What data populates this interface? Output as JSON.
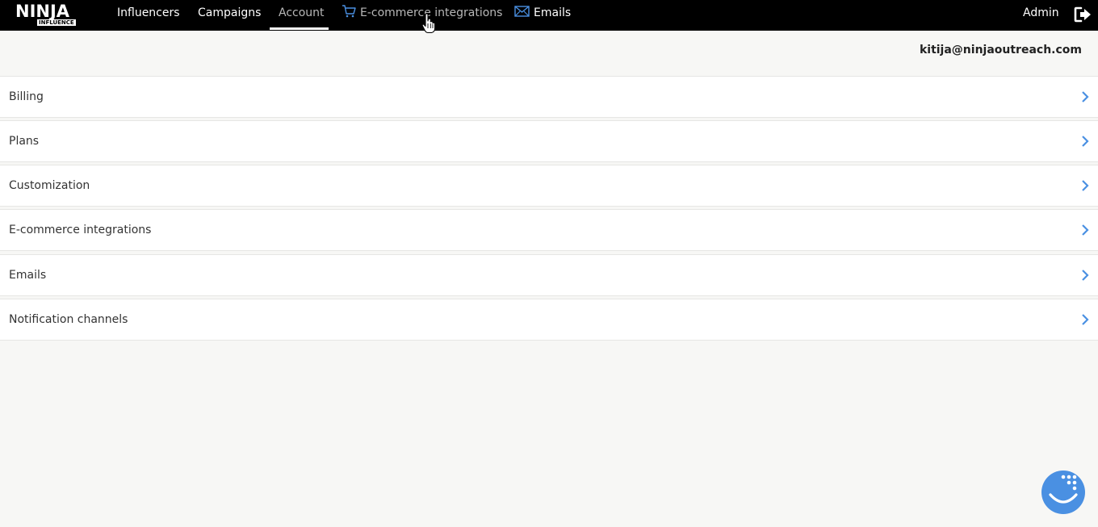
{
  "logo": {
    "main": "NINJA",
    "sub": "INFLUENCE"
  },
  "nav": {
    "influencers": "Influencers",
    "campaigns": "Campaigns",
    "account": "Account",
    "ecommerce": "E-commerce integrations",
    "emails": "Emails",
    "admin": "Admin",
    "active": "Account"
  },
  "user": {
    "email": "kitija@ninjaoutreach.com"
  },
  "menu": [
    {
      "label": "Billing"
    },
    {
      "label": "Plans"
    },
    {
      "label": "Customization"
    },
    {
      "label": "E-commerce integrations"
    },
    {
      "label": "Emails"
    },
    {
      "label": "Notification channels"
    }
  ],
  "colors": {
    "accent": "#4a90e2",
    "topbar": "#000000",
    "background": "#f7f7f5"
  },
  "icons": {
    "cart": "shopping-cart-icon",
    "mail": "envelope-icon",
    "logout": "logout-icon",
    "chevron": "chevron-right-icon",
    "chat": "chat-widget-icon"
  }
}
